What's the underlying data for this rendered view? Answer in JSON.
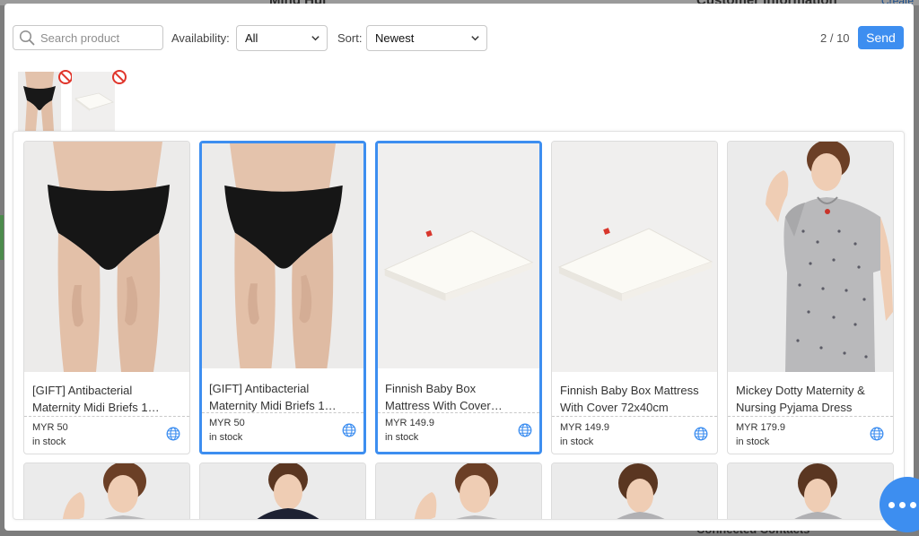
{
  "background": {
    "left_title": "Ming Hui",
    "right_title": "Customer Information",
    "right_link": "Create",
    "bottom_text": "Connected Contacts"
  },
  "toolbar": {
    "search_placeholder": "Search product",
    "availability_label": "Availability:",
    "availability_value": "All",
    "sort_label": "Sort:",
    "sort_value": "Newest",
    "pager": "2 / 10",
    "send_label": "Send"
  },
  "selected_thumbnails": [
    {
      "icon": "remove-icon",
      "product": "briefs"
    },
    {
      "icon": "remove-icon",
      "product": "mattress"
    }
  ],
  "products": [
    {
      "name_line1": "[GIFT] Antibacterial",
      "name_line2": "Maternity Midi Briefs 1…",
      "price": "MYR 50",
      "stock": "in stock",
      "selected": false,
      "image": "briefs"
    },
    {
      "name_line1": "[GIFT] Antibacterial",
      "name_line2": "Maternity Midi Briefs 1…",
      "price": "MYR 50",
      "stock": "in stock",
      "selected": true,
      "image": "briefs"
    },
    {
      "name_line1": "Finnish Baby Box",
      "name_line2": "Mattress With Cover…",
      "price": "MYR 149.9",
      "stock": "in stock",
      "selected": true,
      "image": "mattress"
    },
    {
      "name_line1": "Finnish Baby Box Mattress",
      "name_line2": "With Cover 72x40cm",
      "price": "MYR 149.9",
      "stock": "in stock",
      "selected": false,
      "image": "mattress"
    },
    {
      "name_line1": "Mickey Dotty Maternity &",
      "name_line2": "Nursing Pyjama Dress",
      "price": "MYR 179.9",
      "stock": "in stock",
      "selected": false,
      "image": "dress"
    }
  ],
  "colors": {
    "accent": "#3d8ef0",
    "remove": "#e0352b",
    "globe": "#3d8ef0"
  }
}
